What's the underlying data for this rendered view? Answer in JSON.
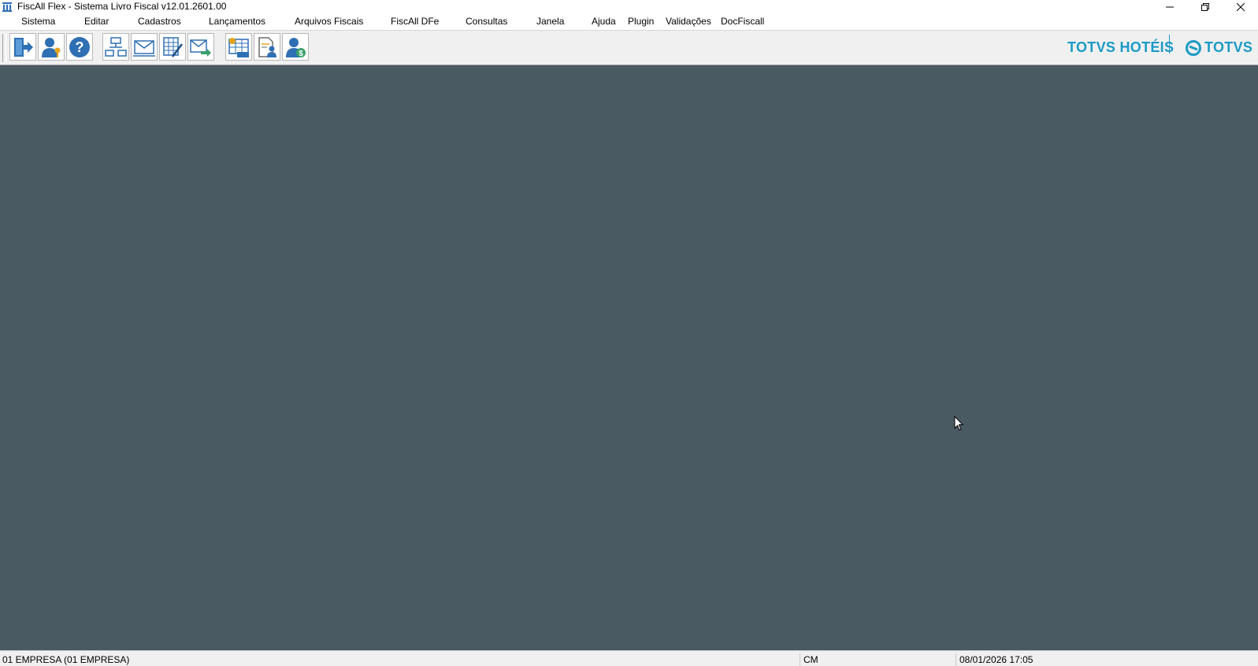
{
  "window": {
    "title": "FiscAll Flex - Sistema Livro Fiscal v12.01.2601.00",
    "app_icon": "building-columns-icon",
    "controls": {
      "minimize": "minimize-icon",
      "restore": "restore-icon",
      "close": "close-icon"
    }
  },
  "menu": {
    "items": [
      {
        "label": "Sistema"
      },
      {
        "label": "Editar"
      },
      {
        "label": "Cadastros"
      },
      {
        "label": "Lançamentos"
      },
      {
        "label": "Arquivos Fiscais"
      },
      {
        "label": "FiscAll DFe"
      },
      {
        "label": "Consultas"
      },
      {
        "label": "Janela"
      },
      {
        "label": "Ajuda"
      },
      {
        "label": "Plugin"
      },
      {
        "label": "Validações"
      },
      {
        "label": "DocFiscall"
      }
    ]
  },
  "toolbar": {
    "buttons": [
      {
        "icon": "exit-door-icon"
      },
      {
        "icon": "user-key-icon"
      },
      {
        "icon": "help-icon"
      },
      {
        "icon": "org-chart-icon"
      },
      {
        "icon": "mail-inbox-icon"
      },
      {
        "icon": "spreadsheet-edit-icon"
      },
      {
        "icon": "mail-forward-icon"
      },
      {
        "icon": "icms-table-icon"
      },
      {
        "icon": "document-user-icon"
      },
      {
        "icon": "user-money-icon"
      }
    ]
  },
  "branding": {
    "hotel_brand": "TOTVS HOTÉIS",
    "company_brand": "TOTVS",
    "accent_color": "#1b9ac5"
  },
  "workspace": {
    "background_color": "#4a5a63"
  },
  "statusbar": {
    "company": "01 EMPRESA (01 EMPRESA)",
    "code": "CM",
    "datetime": "08/01/2026 17:05"
  }
}
